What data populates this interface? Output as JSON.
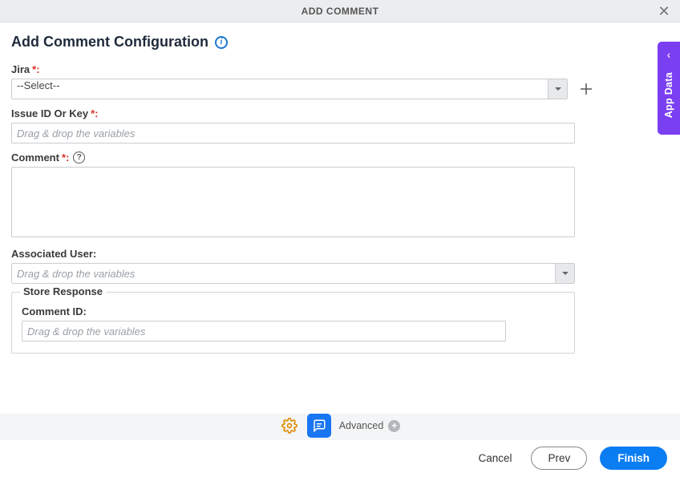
{
  "header": {
    "title": "ADD COMMENT"
  },
  "page": {
    "title": "Add Comment Configuration"
  },
  "fields": {
    "jira": {
      "label": "Jira",
      "required_suffix": "*:",
      "selected": "--Select--"
    },
    "issue": {
      "label": "Issue ID Or Key",
      "required_suffix": "*:",
      "placeholder": "Drag & drop the variables",
      "value": ""
    },
    "comment": {
      "label": "Comment",
      "required_suffix": "*:",
      "value": ""
    },
    "associated_user": {
      "label": "Associated User:",
      "placeholder": "Drag & drop the variables",
      "value": ""
    },
    "store_response": {
      "legend": "Store Response",
      "comment_id": {
        "label": "Comment ID:",
        "placeholder": "Drag & drop the variables",
        "value": ""
      }
    }
  },
  "bottom_bar": {
    "advanced_label": "Advanced"
  },
  "footer": {
    "cancel": "Cancel",
    "prev": "Prev",
    "finish": "Finish"
  },
  "side_tab": {
    "label": "App Data"
  }
}
